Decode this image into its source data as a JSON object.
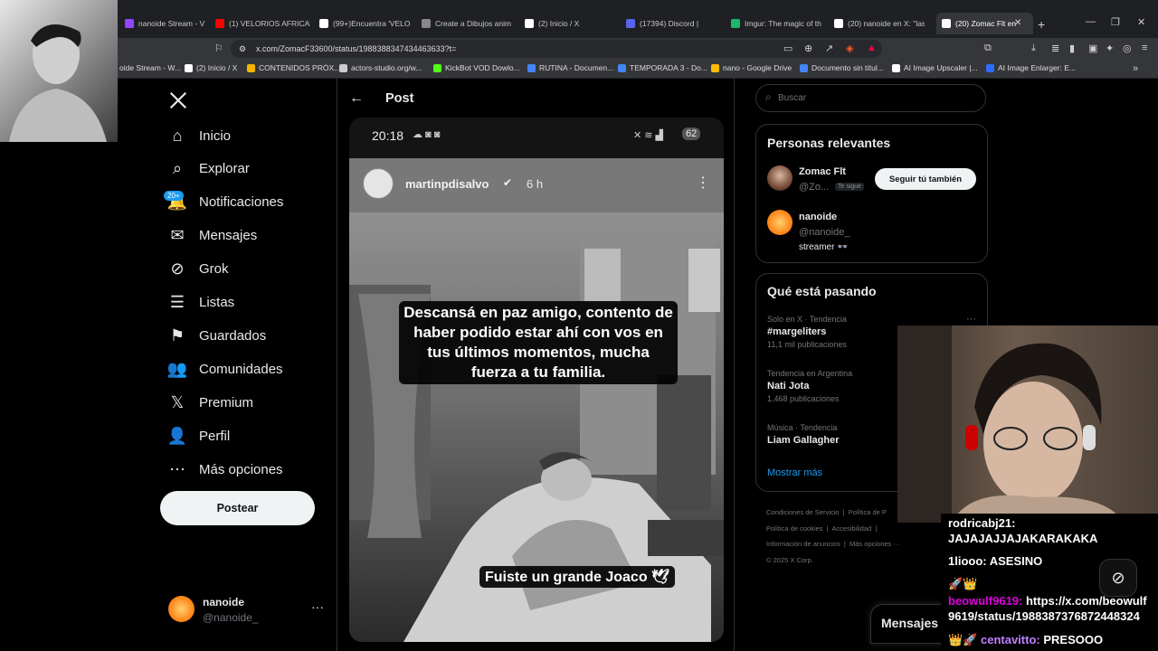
{
  "browser": {
    "tabs": [
      {
        "label": "oide Stream - W",
        "color": "#9146ff"
      },
      {
        "label": "nanoide Stream - V",
        "color": "#9146ff"
      },
      {
        "label": "(1) VELORIOS AFRICAN",
        "color": "#ff0000"
      },
      {
        "label": "(99+)Encuentra 'VELOR",
        "color": "#ffffff"
      },
      {
        "label": "Create a Dibujos anim",
        "color": "#888888"
      },
      {
        "label": "(2) Inicio / X",
        "color": "#ffffff"
      },
      {
        "label": "(17394) Discord |",
        "color": "#5865f2"
      },
      {
        "label": "Imgur: The magic of th",
        "color": "#1bb76e"
      },
      {
        "label": "(20) nanoide en X: \"las",
        "color": "#ffffff"
      },
      {
        "label": "(20) Zomac Flt en",
        "color": "#ffffff"
      }
    ],
    "url": "x.com/ZomacF33600/status/1988388347434463633?t=",
    "bookmarks": [
      {
        "label": "oide Stream - W...",
        "color": "#9146ff"
      },
      {
        "label": "(2) Inicio / X",
        "color": "#ffffff"
      },
      {
        "label": "CONTENIDOS PRÓX...",
        "color": "#f6b400"
      },
      {
        "label": "actors-studio.org/w...",
        "color": "#cccccc"
      },
      {
        "label": "KickBot VOD Dowlo...",
        "color": "#53fc18"
      },
      {
        "label": "RUTINA - Documen...",
        "color": "#4285f4"
      },
      {
        "label": "TEMPORADA 3 - Do...",
        "color": "#4285f4"
      },
      {
        "label": "nano - Google Drive",
        "color": "#fbbc04"
      },
      {
        "label": "Documento sin títul...",
        "color": "#4285f4"
      },
      {
        "label": "AI Image Upscaler |...",
        "color": "#ffffff"
      },
      {
        "label": "AI Image Enlarger: E...",
        "color": "#2b6cff"
      }
    ]
  },
  "nav": {
    "items": [
      {
        "label": "Inicio",
        "icon": "home-icon",
        "glyph": "⌂"
      },
      {
        "label": "Explorar",
        "icon": "search-icon",
        "glyph": "⌕"
      },
      {
        "label": "Notificaciones",
        "icon": "bell-icon",
        "glyph": "🔔"
      },
      {
        "label": "Mensajes",
        "icon": "mail-icon",
        "glyph": "✉"
      },
      {
        "label": "Grok",
        "icon": "grok-icon",
        "glyph": "⊘"
      },
      {
        "label": "Listas",
        "icon": "list-icon",
        "glyph": "☰"
      },
      {
        "label": "Guardados",
        "icon": "bookmark-icon",
        "glyph": "⚑"
      },
      {
        "label": "Comunidades",
        "icon": "people-icon",
        "glyph": "👥"
      },
      {
        "label": "Premium",
        "icon": "x-logo-icon",
        "glyph": "𝕏"
      },
      {
        "label": "Perfil",
        "icon": "person-icon",
        "glyph": "👤"
      },
      {
        "label": "Más opciones",
        "icon": "more-circle-icon",
        "glyph": "⋯"
      }
    ],
    "badge": "20+",
    "post_button": "Postear",
    "account": {
      "name": "nanoide",
      "handle": "@nanoide_"
    }
  },
  "post": {
    "title": "Post",
    "story": {
      "time": "20:18",
      "battery": "62",
      "username": "martinpdisalvo",
      "age": "6 h",
      "caption": "Descansá en paz amigo, contento de haber podido estar ahí con vos en tus últimos momentos, mucha fuerza a tu familia.",
      "caption2": "Fuiste un grande Joaco 🕊"
    }
  },
  "right": {
    "search_placeholder": "Buscar",
    "relevant": {
      "title": "Personas relevantes",
      "people": [
        {
          "name": "Zomac Flt",
          "handle": "@Zo...",
          "badge": "Te sigue",
          "button": "Seguir tú también"
        },
        {
          "name": "nanoide",
          "handle": "@nanoide_",
          "bio": "streamer 👓"
        }
      ]
    },
    "trends": {
      "title": "Qué está pasando",
      "items": [
        {
          "context": "Solo en X · Tendencia",
          "name": "#margeliters",
          "count": "11,1 mil publicaciones"
        },
        {
          "context": "Tendencia en Argentina",
          "name": "Nati Jota",
          "count": "1.468 publicaciones"
        },
        {
          "context": "Música · Tendencia",
          "name": "Liam Gallagher",
          "count": ""
        }
      ],
      "show_more": "Mostrar más"
    },
    "footer": {
      "line1": [
        "Condiciones de Servicio",
        "Política de P"
      ],
      "line2": [
        "Política de cookies",
        "Accesibilidad"
      ],
      "line3": [
        "Información de anuncios",
        "Más opciones ···"
      ],
      "copyright": "© 2025 X Corp."
    },
    "messages_label": "Mensajes"
  },
  "chat": {
    "messages": [
      {
        "user": "rodricabj21:",
        "text": "JAJAJAJJAJAKARAKAKA",
        "color": "#ffffff"
      },
      {
        "user": "1liooo:",
        "text": "ASESINO",
        "color": "#ffffff"
      },
      {
        "user": "🚀👑",
        "text": "",
        "color": "#ffffff"
      },
      {
        "user": "beowulf9619:",
        "text": "https://x.com/beowulf9619/status/1988387376872448324",
        "color": "#e000e0"
      },
      {
        "user": "👑🚀 centavitto:",
        "text": "PRESOOO",
        "color": "#c080ff"
      }
    ]
  }
}
